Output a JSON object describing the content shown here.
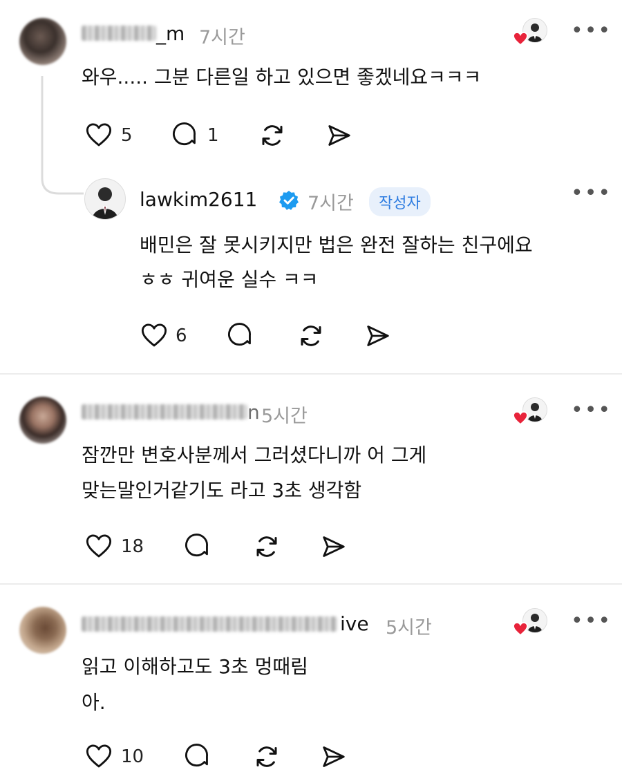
{
  "comments": [
    {
      "username_visible": "_m",
      "time": "7시간",
      "text": "와우..... 그분 다른일 하고 있으면 좋겠네요ㅋㅋㅋ",
      "likes": "5",
      "replies": "1"
    },
    {
      "username": "lawkim2611",
      "time": "7시간",
      "badge": "작성자",
      "text_line1": "배민은 잘 못시키지만 법은 완전 잘하는 친구에요",
      "text_line2": "ㅎㅎ 귀여운 실수 ㅋㅋ",
      "likes": "6"
    },
    {
      "username_visible": "n",
      "time": "5시간",
      "text_line1": "잠깐만 변호사분께서 그러셨다니까 어 그게",
      "text_line2": "맞는말인거같기도 라고 3초 생각함",
      "likes": "18"
    },
    {
      "username_visible": "ive",
      "time": "5시간",
      "text_line1": "읽고 이해하고도 3초 멍때림",
      "text_line2": "아.",
      "likes": "10"
    }
  ],
  "colors": {
    "verified": "#1d9bf0",
    "heart": "#e8233a",
    "badge_text": "#2f7de1"
  }
}
